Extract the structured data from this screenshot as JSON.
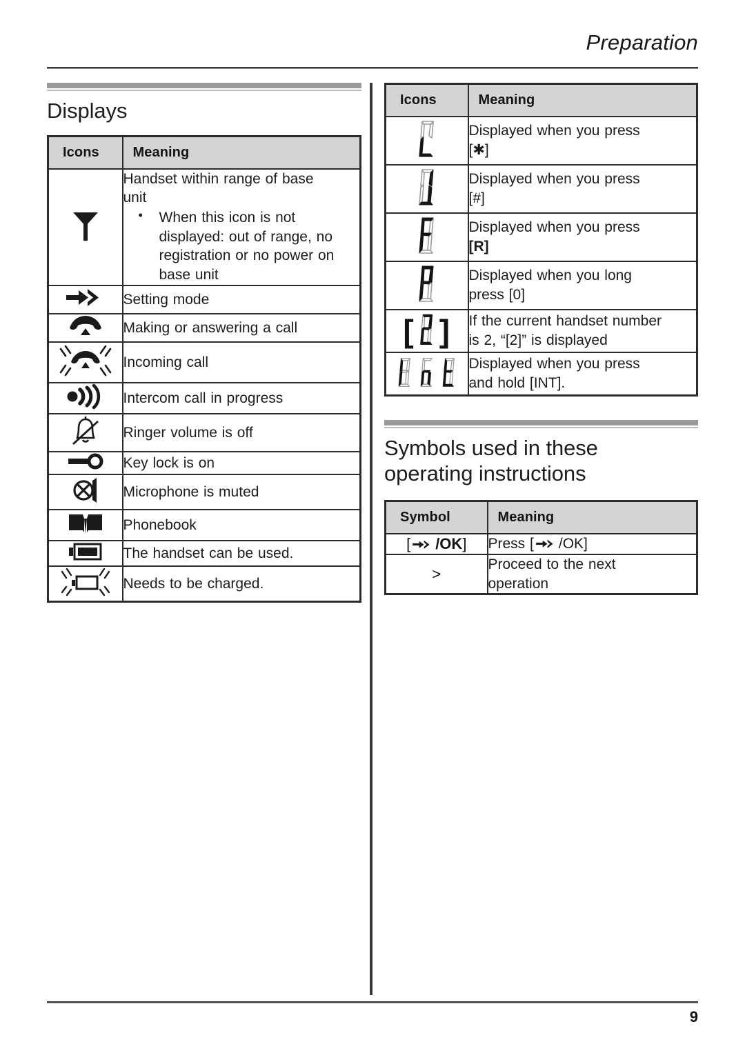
{
  "header": {
    "title": "Preparation"
  },
  "footer": {
    "page_number": "9"
  },
  "sections": {
    "displays": {
      "heading": "Displays",
      "table": {
        "columns": [
          "Icons",
          "Meaning"
        ],
        "rows": [
          {
            "icon": "antenna-icon",
            "meaning_lines": [
              "Handset within range of base",
              "unit"
            ],
            "bullets": [
              "When this icon is not displayed: out of range, no registration or no power on base unit"
            ]
          },
          {
            "icon": "setting-mode-arrow-icon",
            "meaning": "Setting mode"
          },
          {
            "icon": "handset-offhook-icon",
            "meaning": "Making or answering a call"
          },
          {
            "icon": "incoming-call-ringing-icon",
            "meaning": "Incoming call"
          },
          {
            "icon": "intercom-waves-icon",
            "meaning": "Intercom call in progress"
          },
          {
            "icon": "bell-muted-icon",
            "meaning": "Ringer volume is off"
          },
          {
            "icon": "key-lock-icon",
            "meaning": "Key lock is on"
          },
          {
            "icon": "microphone-muted-icon",
            "meaning": "Microphone is muted"
          },
          {
            "icon": "phonebook-icon",
            "meaning": "Phonebook"
          },
          {
            "icon": "battery-full-icon",
            "meaning": "The handset can be used."
          },
          {
            "icon": "battery-low-flashing-icon",
            "meaning": "Needs to be charged."
          }
        ]
      }
    },
    "display_codes": {
      "table": {
        "columns": [
          "Icons",
          "Meaning"
        ],
        "rows": [
          {
            "icon": "seven-segment-L",
            "glyph": "L",
            "meaning_lines": [
              "Displayed when you press",
              "[✱]"
            ]
          },
          {
            "icon": "seven-segment-U",
            "glyph": "U",
            "meaning_lines": [
              "Displayed when you press",
              "[#]"
            ]
          },
          {
            "icon": "seven-segment-F",
            "glyph": "F",
            "meaning_prefix": "Displayed when you press",
            "meaning_key": "[R]"
          },
          {
            "icon": "seven-segment-P",
            "glyph": "P",
            "meaning_prefix": "Displayed when you long",
            "meaning_key": "press [0]"
          },
          {
            "icon": "seven-segment-bracket-2",
            "glyph": "[2]",
            "meaning_lines": [
              "If the current handset number",
              "is 2, “[2]” is displayed"
            ]
          },
          {
            "icon": "seven-segment-Int",
            "glyph": "Int",
            "meaning_prefix": "Displayed when you press",
            "meaning_key": "and hold [INT]."
          }
        ]
      }
    },
    "symbols": {
      "heading_lines": [
        "Symbols used in these",
        "operating instructions"
      ],
      "table": {
        "columns": [
          "Symbol",
          "Meaning"
        ],
        "rows": [
          {
            "symbol": "[↠ /OK]",
            "symbol_icon": "ok-arrow-icon",
            "meaning": "Press [↠ /OK]",
            "meaning_icon": "ok-arrow-icon"
          },
          {
            "symbol": ">",
            "symbol_icon": "greater-than-symbol",
            "meaning_lines": [
              "Proceed to the next",
              "operation"
            ]
          }
        ]
      }
    }
  },
  "colors": {
    "rule": "#3a3a3c",
    "table_border": "#2b2b2d",
    "table_header_bg": "#d3d4d5",
    "section_bar": "#9a9a9c",
    "text": "#1b1c1e"
  }
}
